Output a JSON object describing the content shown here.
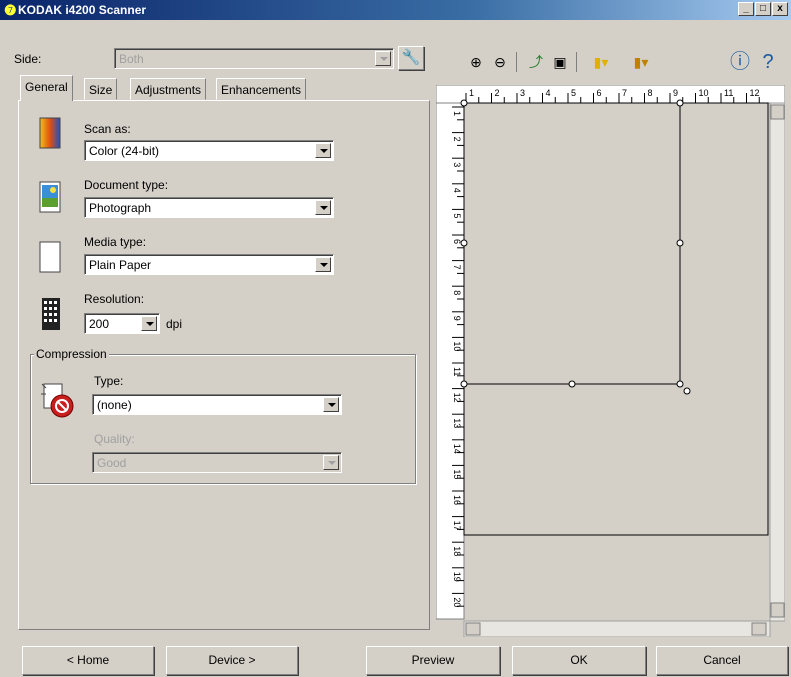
{
  "window": {
    "title": "KODAK i4200 Scanner",
    "logo": "kodak-logo",
    "controls": [
      "_",
      "□",
      "x"
    ]
  },
  "side": {
    "label": "Side:",
    "value": "Both"
  },
  "tabs": [
    {
      "label": "General",
      "active": true
    },
    {
      "label": "Size",
      "active": false
    },
    {
      "label": "Adjustments",
      "active": false
    },
    {
      "label": "Enhancements",
      "active": false
    }
  ],
  "general": {
    "scan_as": {
      "label": "Scan as:",
      "value": "Color (24-bit)"
    },
    "document_type": {
      "label": "Document type:",
      "value": "Photograph"
    },
    "media_type": {
      "label": "Media type:",
      "value": "Plain Paper"
    },
    "resolution": {
      "label": "Resolution:",
      "value": "200",
      "unit": "dpi"
    },
    "compression": {
      "group_label": "Compression",
      "type": {
        "label": "Type:",
        "value": "(none)"
      },
      "quality": {
        "label": "Quality:",
        "value": "Good"
      }
    }
  },
  "ruler": {
    "horizontal": [
      "1",
      "2",
      "3",
      "4",
      "5",
      "6",
      "7",
      "8",
      "9",
      "10",
      "11",
      "12"
    ],
    "vertical": [
      "1",
      "2",
      "3",
      "4",
      "5",
      "6",
      "7",
      "8",
      "9",
      "10",
      "11",
      "12",
      "13",
      "14",
      "15",
      "16",
      "17",
      "18",
      "19",
      "20"
    ]
  },
  "footer": {
    "home": "< Home",
    "device": "Device >",
    "preview": "Preview",
    "ok": "OK",
    "cancel": "Cancel"
  },
  "icons": {
    "title_logo": "kodak-logo",
    "settings": "scanner-settings-icon",
    "zoom_in": "zoom-in-icon",
    "zoom_out": "zoom-out-icon",
    "rotate": "rotate-icon",
    "fit": "fit-page-icon",
    "brightness": "brightness-icon",
    "color": "color-icon",
    "info": "info-icon",
    "help": "help-icon"
  }
}
